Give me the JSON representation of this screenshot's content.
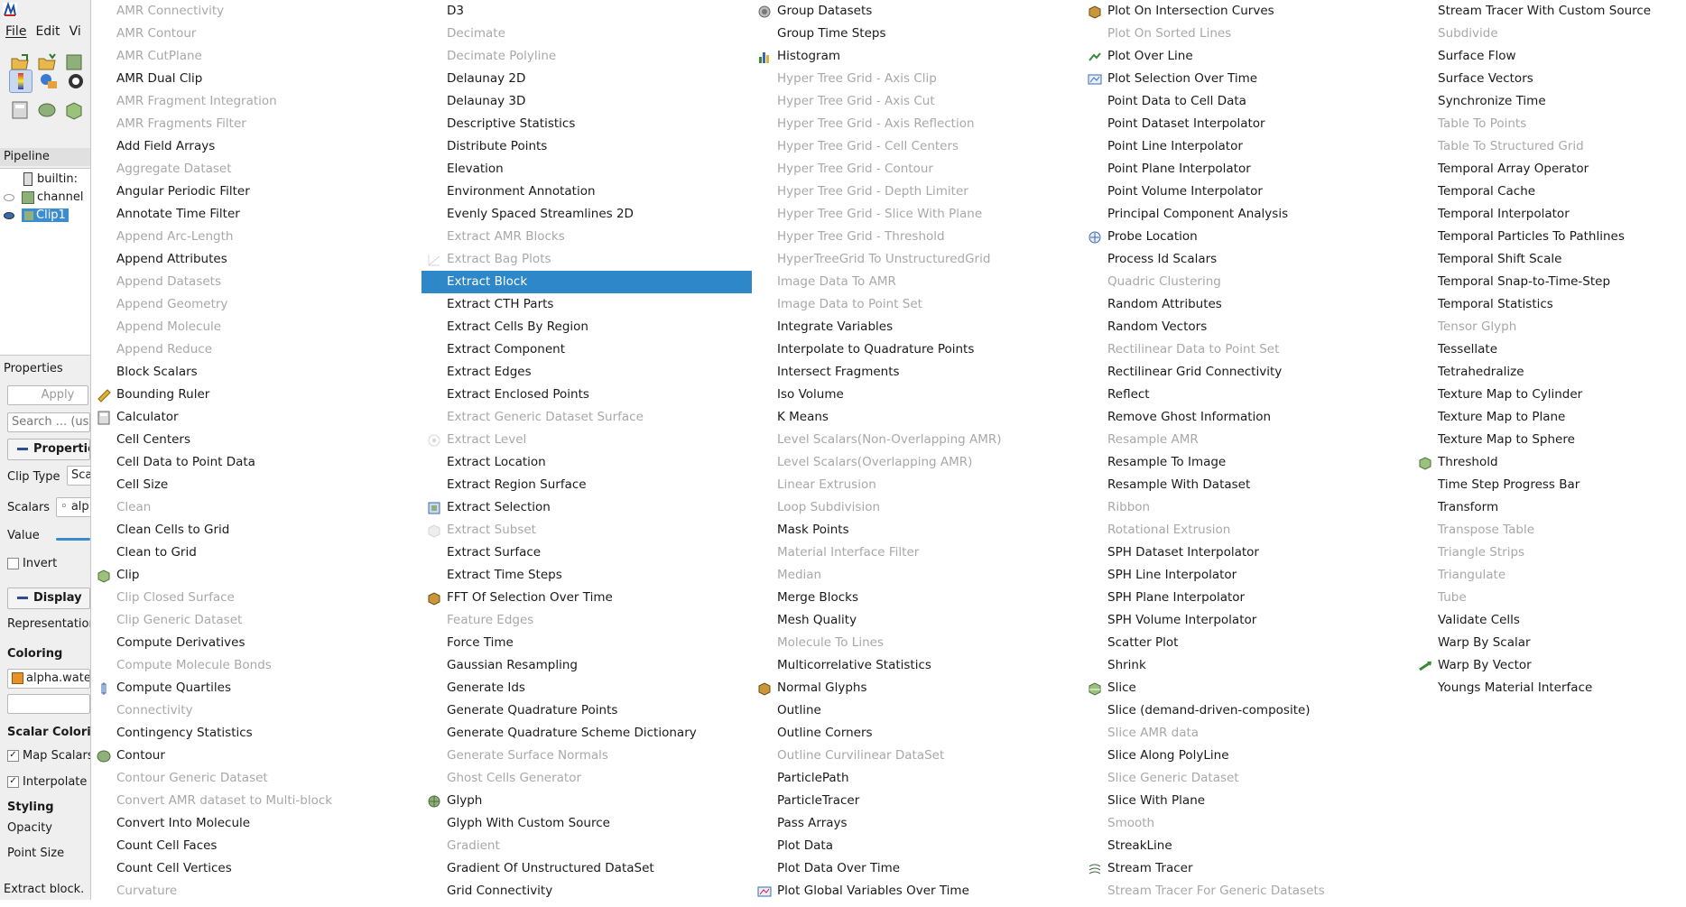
{
  "status_text": "Extract block.",
  "app": {
    "menus": [
      "File",
      "Edit",
      "Vi"
    ],
    "pipeline_header": "Pipeline Browser",
    "pipeline_items": [
      "builtin:",
      "channel",
      "Clip1"
    ],
    "properties_header": "Properties",
    "apply_label": "Apply",
    "search_placeholder": "Search ... (use",
    "properties_section": "Properties",
    "clip_type_label": "Clip Type",
    "clip_type_value": "Sca",
    "scalars_label": "Scalars",
    "scalars_value": "alp",
    "value_label": "Value",
    "invert_label": "Invert",
    "display_section": "Display",
    "representation_label": "Representation",
    "coloring_label": "Coloring",
    "coloring_value": "alpha.wate",
    "scalar_coloring_label": "Scalar Coloring",
    "map_scalars_label": "Map Scalars",
    "interpolate_label": "Interpolate",
    "styling_label": "Styling",
    "opacity_label": "Opacity",
    "point_size_label": "Point Size"
  },
  "columns": [
    [
      {
        "label": "AMR Connectivity",
        "enabled": false
      },
      {
        "label": "AMR Contour",
        "enabled": false
      },
      {
        "label": "AMR CutPlane",
        "enabled": false
      },
      {
        "label": "AMR Dual Clip",
        "enabled": true
      },
      {
        "label": "AMR Fragment Integration",
        "enabled": false
      },
      {
        "label": "AMR Fragments Filter",
        "enabled": false
      },
      {
        "label": "Add Field Arrays",
        "enabled": true
      },
      {
        "label": "Aggregate Dataset",
        "enabled": false
      },
      {
        "label": "Angular Periodic Filter",
        "enabled": true
      },
      {
        "label": "Annotate Time Filter",
        "enabled": true
      },
      {
        "label": "Append Arc-Length",
        "enabled": false
      },
      {
        "label": "Append Attributes",
        "enabled": true
      },
      {
        "label": "Append Datasets",
        "enabled": false
      },
      {
        "label": "Append Geometry",
        "enabled": false
      },
      {
        "label": "Append Molecule",
        "enabled": false
      },
      {
        "label": "Append Reduce",
        "enabled": false
      },
      {
        "label": "Block Scalars",
        "enabled": true
      },
      {
        "label": "Bounding Ruler",
        "enabled": true,
        "icon": "ruler-icon"
      },
      {
        "label": "Calculator",
        "enabled": true,
        "icon": "calculator-icon"
      },
      {
        "label": "Cell Centers",
        "enabled": true
      },
      {
        "label": "Cell Data to Point Data",
        "enabled": true
      },
      {
        "label": "Cell Size",
        "enabled": true
      },
      {
        "label": "Clean",
        "enabled": false
      },
      {
        "label": "Clean Cells to Grid",
        "enabled": true
      },
      {
        "label": "Clean to Grid",
        "enabled": true
      },
      {
        "label": "Clip",
        "enabled": true,
        "icon": "clip-icon"
      },
      {
        "label": "Clip Closed Surface",
        "enabled": false
      },
      {
        "label": "Clip Generic Dataset",
        "enabled": false
      },
      {
        "label": "Compute Derivatives",
        "enabled": true
      },
      {
        "label": "Compute Molecule Bonds",
        "enabled": false
      },
      {
        "label": "Compute Quartiles",
        "enabled": true,
        "icon": "quartiles-icon"
      },
      {
        "label": "Connectivity",
        "enabled": false
      },
      {
        "label": "Contingency Statistics",
        "enabled": true
      },
      {
        "label": "Contour",
        "enabled": true,
        "icon": "contour-icon"
      },
      {
        "label": "Contour Generic Dataset",
        "enabled": false
      },
      {
        "label": "Convert AMR dataset to Multi-block",
        "enabled": false
      },
      {
        "label": "Convert Into Molecule",
        "enabled": true
      },
      {
        "label": "Count Cell Faces",
        "enabled": true
      },
      {
        "label": "Count Cell Vertices",
        "enabled": true
      },
      {
        "label": "Curvature",
        "enabled": false
      }
    ],
    [
      {
        "label": "D3",
        "enabled": true
      },
      {
        "label": "Decimate",
        "enabled": false
      },
      {
        "label": "Decimate Polyline",
        "enabled": false
      },
      {
        "label": "Delaunay 2D",
        "enabled": true
      },
      {
        "label": "Delaunay 3D",
        "enabled": true
      },
      {
        "label": "Descriptive Statistics",
        "enabled": true
      },
      {
        "label": "Distribute Points",
        "enabled": true
      },
      {
        "label": "Elevation",
        "enabled": true
      },
      {
        "label": "Environment Annotation",
        "enabled": true
      },
      {
        "label": "Evenly Spaced Streamlines 2D",
        "enabled": true
      },
      {
        "label": "Extract AMR Blocks",
        "enabled": false
      },
      {
        "label": "Extract Bag Plots",
        "enabled": false,
        "icon": "bag-plot-icon"
      },
      {
        "label": "Extract Block",
        "enabled": true,
        "selected": true
      },
      {
        "label": "Extract CTH Parts",
        "enabled": true
      },
      {
        "label": "Extract Cells By Region",
        "enabled": true
      },
      {
        "label": "Extract Component",
        "enabled": true
      },
      {
        "label": "Extract Edges",
        "enabled": true
      },
      {
        "label": "Extract Enclosed Points",
        "enabled": true
      },
      {
        "label": "Extract Generic Dataset Surface",
        "enabled": false
      },
      {
        "label": "Extract Level",
        "enabled": false,
        "icon": "extract-level-icon"
      },
      {
        "label": "Extract Location",
        "enabled": true
      },
      {
        "label": "Extract Region Surface",
        "enabled": true
      },
      {
        "label": "Extract Selection",
        "enabled": true,
        "icon": "extract-selection-icon"
      },
      {
        "label": "Extract Subset",
        "enabled": false,
        "icon": "extract-subset-icon"
      },
      {
        "label": "Extract Surface",
        "enabled": true
      },
      {
        "label": "Extract Time Steps",
        "enabled": true
      },
      {
        "label": "FFT Of Selection Over Time",
        "enabled": true,
        "icon": "fft-icon"
      },
      {
        "label": "Feature Edges",
        "enabled": false
      },
      {
        "label": "Force Time",
        "enabled": true
      },
      {
        "label": "Gaussian Resampling",
        "enabled": true
      },
      {
        "label": "Generate Ids",
        "enabled": true
      },
      {
        "label": "Generate Quadrature Points",
        "enabled": true
      },
      {
        "label": "Generate Quadrature Scheme Dictionary",
        "enabled": true
      },
      {
        "label": "Generate Surface Normals",
        "enabled": false
      },
      {
        "label": "Ghost Cells Generator",
        "enabled": false
      },
      {
        "label": "Glyph",
        "enabled": true,
        "icon": "glyph-icon"
      },
      {
        "label": "Glyph With Custom Source",
        "enabled": true
      },
      {
        "label": "Gradient",
        "enabled": false
      },
      {
        "label": "Gradient Of Unstructured DataSet",
        "enabled": true
      },
      {
        "label": "Grid Connectivity",
        "enabled": true
      }
    ],
    [
      {
        "label": "Group Datasets",
        "enabled": true,
        "icon": "group-datasets-icon"
      },
      {
        "label": "Group Time Steps",
        "enabled": true
      },
      {
        "label": "Histogram",
        "enabled": true,
        "icon": "histogram-icon"
      },
      {
        "label": "Hyper Tree Grid - Axis Clip",
        "enabled": false
      },
      {
        "label": "Hyper Tree Grid - Axis Cut",
        "enabled": false
      },
      {
        "label": "Hyper Tree Grid - Axis Reflection",
        "enabled": false
      },
      {
        "label": "Hyper Tree Grid - Cell Centers",
        "enabled": false
      },
      {
        "label": "Hyper Tree Grid - Contour",
        "enabled": false
      },
      {
        "label": "Hyper Tree Grid - Depth Limiter",
        "enabled": false
      },
      {
        "label": "Hyper Tree Grid - Slice With Plane",
        "enabled": false
      },
      {
        "label": "Hyper Tree Grid - Threshold",
        "enabled": false
      },
      {
        "label": "HyperTreeGrid To UnstructuredGrid",
        "enabled": false
      },
      {
        "label": "Image Data To AMR",
        "enabled": false
      },
      {
        "label": "Image Data to Point Set",
        "enabled": false
      },
      {
        "label": "Integrate Variables",
        "enabled": true
      },
      {
        "label": "Interpolate to Quadrature Points",
        "enabled": true
      },
      {
        "label": "Intersect Fragments",
        "enabled": true
      },
      {
        "label": "Iso Volume",
        "enabled": true
      },
      {
        "label": "K Means",
        "enabled": true
      },
      {
        "label": "Level Scalars(Non-Overlapping AMR)",
        "enabled": false
      },
      {
        "label": "Level Scalars(Overlapping AMR)",
        "enabled": false
      },
      {
        "label": "Linear Extrusion",
        "enabled": false
      },
      {
        "label": "Loop Subdivision",
        "enabled": false
      },
      {
        "label": "Mask Points",
        "enabled": true
      },
      {
        "label": "Material Interface Filter",
        "enabled": false
      },
      {
        "label": "Median",
        "enabled": false
      },
      {
        "label": "Merge Blocks",
        "enabled": true
      },
      {
        "label": "Mesh Quality",
        "enabled": true
      },
      {
        "label": "Molecule To Lines",
        "enabled": false
      },
      {
        "label": "Multicorrelative Statistics",
        "enabled": true
      },
      {
        "label": "Normal Glyphs",
        "enabled": true,
        "icon": "normal-glyphs-icon"
      },
      {
        "label": "Outline",
        "enabled": true
      },
      {
        "label": "Outline Corners",
        "enabled": true
      },
      {
        "label": "Outline Curvilinear DataSet",
        "enabled": false
      },
      {
        "label": "ParticlePath",
        "enabled": true
      },
      {
        "label": "ParticleTracer",
        "enabled": true
      },
      {
        "label": "Pass Arrays",
        "enabled": true
      },
      {
        "label": "Plot Data",
        "enabled": true
      },
      {
        "label": "Plot Data Over Time",
        "enabled": true
      },
      {
        "label": "Plot Global Variables Over Time",
        "enabled": true,
        "icon": "plot-global-icon"
      }
    ],
    [
      {
        "label": "Plot On Intersection Curves",
        "enabled": true,
        "icon": "intersection-curves-icon"
      },
      {
        "label": "Plot On Sorted Lines",
        "enabled": false
      },
      {
        "label": "Plot Over Line",
        "enabled": true,
        "icon": "plot-over-line-icon"
      },
      {
        "label": "Plot Selection Over Time",
        "enabled": true,
        "icon": "plot-selection-icon"
      },
      {
        "label": "Point Data to Cell Data",
        "enabled": true
      },
      {
        "label": "Point Dataset Interpolator",
        "enabled": true
      },
      {
        "label": "Point Line Interpolator",
        "enabled": true
      },
      {
        "label": "Point Plane Interpolator",
        "enabled": true
      },
      {
        "label": "Point Volume Interpolator",
        "enabled": true
      },
      {
        "label": "Principal Component Analysis",
        "enabled": true
      },
      {
        "label": "Probe Location",
        "enabled": true,
        "icon": "probe-icon"
      },
      {
        "label": "Process Id Scalars",
        "enabled": true
      },
      {
        "label": "Quadric Clustering",
        "enabled": false
      },
      {
        "label": "Random Attributes",
        "enabled": true
      },
      {
        "label": "Random Vectors",
        "enabled": true
      },
      {
        "label": "Rectilinear Data to Point Set",
        "enabled": false
      },
      {
        "label": "Rectilinear Grid Connectivity",
        "enabled": true
      },
      {
        "label": "Reflect",
        "enabled": true
      },
      {
        "label": "Remove Ghost Information",
        "enabled": true
      },
      {
        "label": "Resample AMR",
        "enabled": false
      },
      {
        "label": "Resample To Image",
        "enabled": true
      },
      {
        "label": "Resample With Dataset",
        "enabled": true
      },
      {
        "label": "Ribbon",
        "enabled": false
      },
      {
        "label": "Rotational Extrusion",
        "enabled": false
      },
      {
        "label": "SPH Dataset Interpolator",
        "enabled": true
      },
      {
        "label": "SPH Line Interpolator",
        "enabled": true
      },
      {
        "label": "SPH Plane Interpolator",
        "enabled": true
      },
      {
        "label": "SPH Volume Interpolator",
        "enabled": true
      },
      {
        "label": "Scatter Plot",
        "enabled": true
      },
      {
        "label": "Shrink",
        "enabled": true
      },
      {
        "label": "Slice",
        "enabled": true,
        "icon": "slice-icon"
      },
      {
        "label": "Slice (demand-driven-composite)",
        "enabled": true
      },
      {
        "label": "Slice AMR data",
        "enabled": false
      },
      {
        "label": "Slice Along PolyLine",
        "enabled": true
      },
      {
        "label": "Slice Generic Dataset",
        "enabled": false
      },
      {
        "label": "Slice With Plane",
        "enabled": true
      },
      {
        "label": "Smooth",
        "enabled": false
      },
      {
        "label": "StreakLine",
        "enabled": true
      },
      {
        "label": "Stream Tracer",
        "enabled": true,
        "icon": "stream-tracer-icon"
      },
      {
        "label": "Stream Tracer For Generic Datasets",
        "enabled": false
      }
    ],
    [
      {
        "label": "Stream Tracer With Custom Source",
        "enabled": true
      },
      {
        "label": "Subdivide",
        "enabled": false
      },
      {
        "label": "Surface Flow",
        "enabled": true
      },
      {
        "label": "Surface Vectors",
        "enabled": true
      },
      {
        "label": "Synchronize Time",
        "enabled": true
      },
      {
        "label": "Table To Points",
        "enabled": false
      },
      {
        "label": "Table To Structured Grid",
        "enabled": false
      },
      {
        "label": "Temporal Array Operator",
        "enabled": true
      },
      {
        "label": "Temporal Cache",
        "enabled": true
      },
      {
        "label": "Temporal Interpolator",
        "enabled": true
      },
      {
        "label": "Temporal Particles To Pathlines",
        "enabled": true
      },
      {
        "label": "Temporal Shift Scale",
        "enabled": true
      },
      {
        "label": "Temporal Snap-to-Time-Step",
        "enabled": true
      },
      {
        "label": "Temporal Statistics",
        "enabled": true
      },
      {
        "label": "Tensor Glyph",
        "enabled": false
      },
      {
        "label": "Tessellate",
        "enabled": true
      },
      {
        "label": "Tetrahedralize",
        "enabled": true
      },
      {
        "label": "Texture Map to Cylinder",
        "enabled": true
      },
      {
        "label": "Texture Map to Plane",
        "enabled": true
      },
      {
        "label": "Texture Map to Sphere",
        "enabled": true
      },
      {
        "label": "Threshold",
        "enabled": true,
        "icon": "threshold-icon"
      },
      {
        "label": "Time Step Progress Bar",
        "enabled": true
      },
      {
        "label": "Transform",
        "enabled": true
      },
      {
        "label": "Transpose Table",
        "enabled": false
      },
      {
        "label": "Triangle Strips",
        "enabled": false
      },
      {
        "label": "Triangulate",
        "enabled": false
      },
      {
        "label": "Tube",
        "enabled": false
      },
      {
        "label": "Validate Cells",
        "enabled": true
      },
      {
        "label": "Warp By Scalar",
        "enabled": true
      },
      {
        "label": "Warp By Vector",
        "enabled": true,
        "icon": "warp-vector-icon"
      },
      {
        "label": "Youngs Material Interface",
        "enabled": true
      }
    ]
  ],
  "colors": {
    "selection": "#2e87c8",
    "disabled_text": "#a8a8a8"
  }
}
